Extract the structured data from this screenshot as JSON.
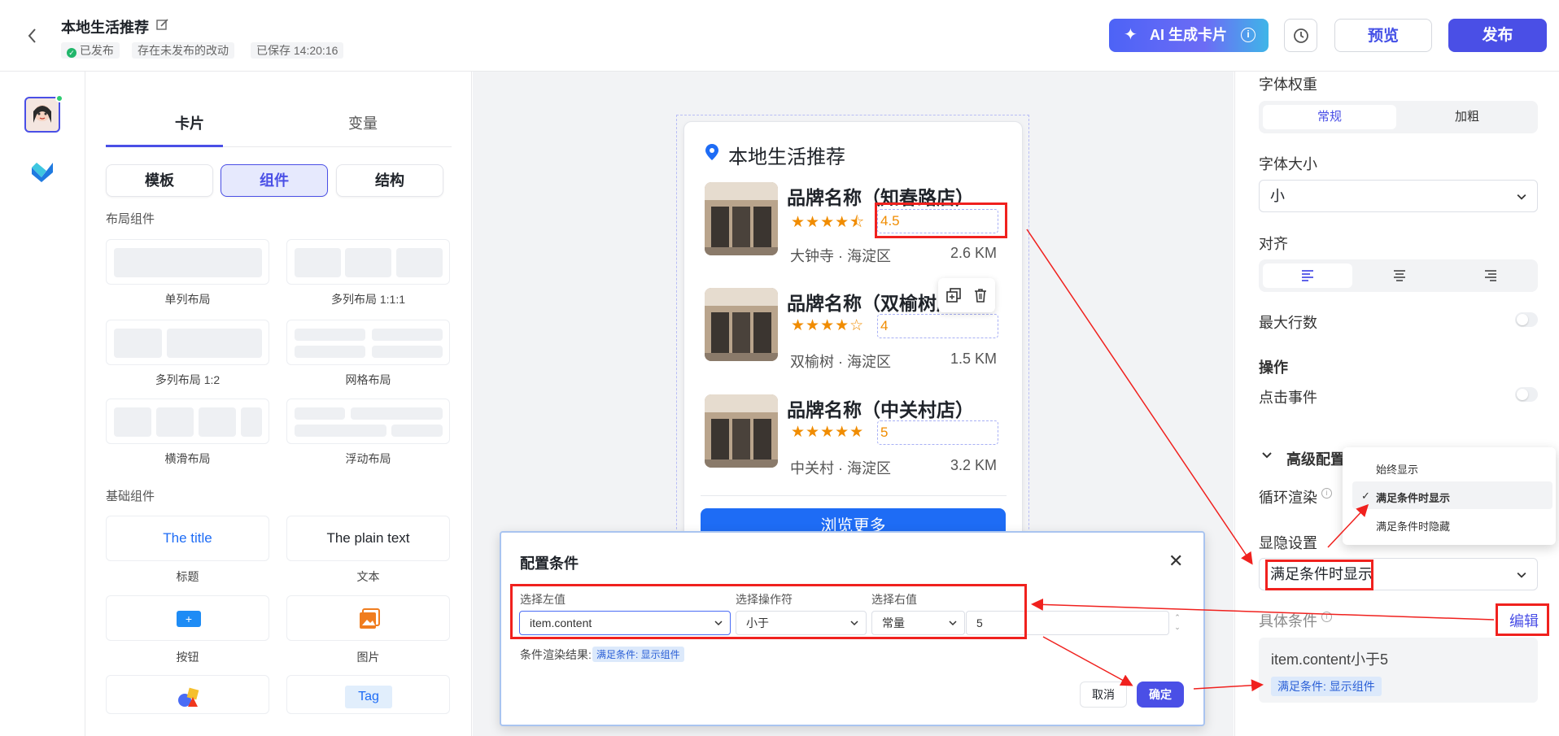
{
  "header": {
    "title": "本地生活推荐",
    "status_published": "已发布",
    "status_unpublished": "存在未发布的改动",
    "status_saved": "已保存 14:20:16",
    "ai_button": "AI 生成卡片",
    "preview_button": "预览",
    "publish_button": "发布"
  },
  "panel": {
    "tabs": [
      "卡片",
      "变量"
    ],
    "segments": [
      "模板",
      "组件",
      "结构"
    ],
    "layout_section": "布局组件",
    "layouts": [
      "单列布局",
      "多列布局 1:1:1",
      "多列布局 1:2",
      "网格布局",
      "横滑布局",
      "浮动布局"
    ],
    "basic_section": "基础组件",
    "basic_title_sample": "The title",
    "basic_text_sample": "The plain text",
    "basic_tag_sample": "Tag",
    "basic_labels": [
      "标题",
      "文本",
      "按钮",
      "图片"
    ]
  },
  "preview": {
    "title": "本地生活推荐",
    "items": [
      {
        "name": "品牌名称（知春路店）",
        "stars": "★★★★⯪",
        "rating": "4.5",
        "address": "大钟寺 · 海淀区",
        "distance": "2.6 KM"
      },
      {
        "name": "品牌名称（双榆树店）",
        "stars": "★★★★☆",
        "rating": "4",
        "address": "双榆树 · 海淀区",
        "distance": "1.5 KM"
      },
      {
        "name": "品牌名称（中关村店）",
        "stars": "★★★★★",
        "rating": "5",
        "address": "中关村 · 海淀区",
        "distance": "3.2 KM"
      }
    ],
    "more_button": "浏览更多"
  },
  "dialog": {
    "title": "配置条件",
    "left_label": "选择左值",
    "op_label": "选择操作符",
    "right_label": "选择右值",
    "left_value": "item.content",
    "op_value": "小于",
    "right_type": "常量",
    "right_value": "5",
    "result_label": "条件渲染结果:",
    "result_badge": "满足条件: 显示组件",
    "cancel": "取消",
    "confirm": "确定"
  },
  "right_panel": {
    "font_weight_label": "字体权重",
    "font_weight_options": [
      "常规",
      "加粗"
    ],
    "font_size_label": "字体大小",
    "font_size_value": "小",
    "align_label": "对齐",
    "max_lines_label": "最大行数",
    "action_section": "操作",
    "click_event_label": "点击事件",
    "advanced_section": "高级配置",
    "loop_label": "循环渲染",
    "visibility_label": "显隐设置",
    "visibility_value": "满足条件时显示",
    "condition_label": "具体条件",
    "edit_link": "编辑",
    "condition_text": "item.content小于5",
    "condition_badge": "满足条件: 显示组件",
    "dropdown_options": [
      "始终显示",
      "满足条件时显示",
      "满足条件时隐藏"
    ]
  }
}
